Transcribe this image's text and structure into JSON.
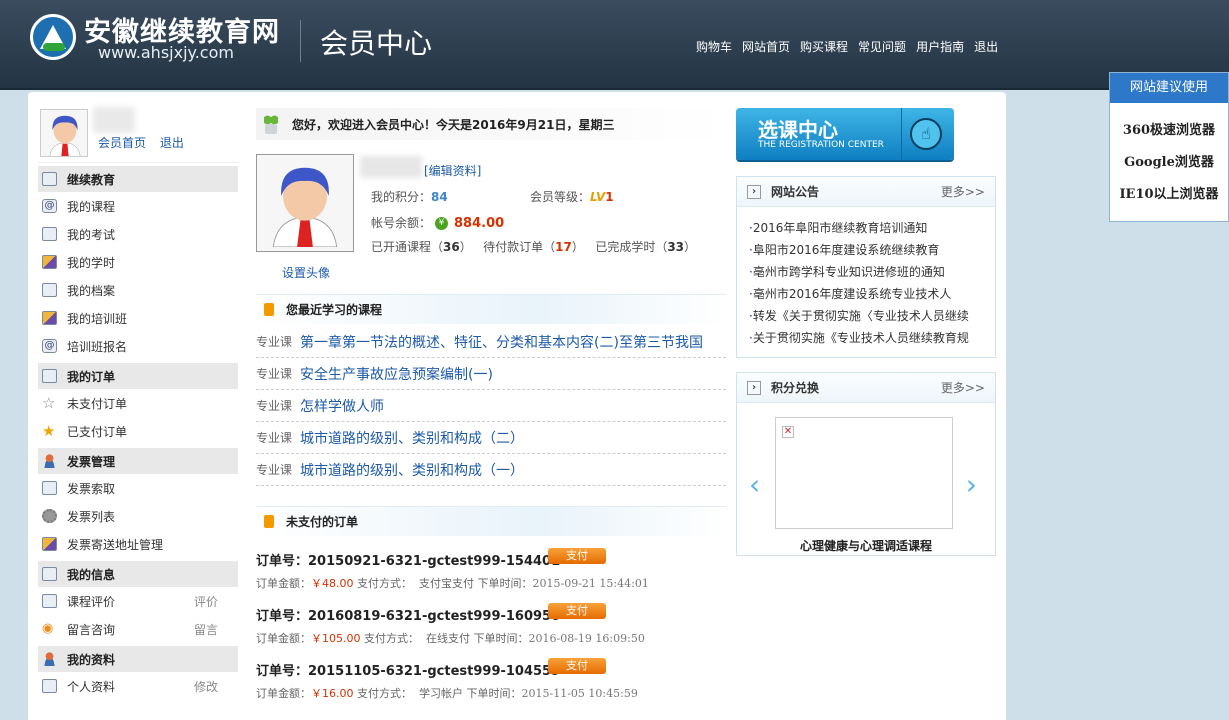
{
  "header": {
    "site_name": "安徽继续教育网",
    "site_url": "www.ahsjxjy.com",
    "section_title": "会员中心",
    "nav": [
      "购物车",
      "网站首页",
      "购买课程",
      "常见问题",
      "用户指南",
      "退出"
    ]
  },
  "suggest": {
    "title": "网站建议使用",
    "browsers": [
      "360极速浏览器",
      "Google浏览器",
      "IE10以上浏览器"
    ]
  },
  "sidebar": {
    "user_links": [
      "会员首页",
      "退出"
    ],
    "sections": [
      {
        "title": "继续教育",
        "items": [
          {
            "label": "我的课程"
          },
          {
            "label": "我的考试"
          },
          {
            "label": "我的学时"
          },
          {
            "label": "我的档案"
          },
          {
            "label": "我的培训班"
          },
          {
            "label": "培训班报名"
          }
        ]
      },
      {
        "title": "我的订单",
        "items": [
          {
            "label": "未支付订单"
          },
          {
            "label": "已支付订单"
          }
        ]
      },
      {
        "title": "发票管理",
        "items": [
          {
            "label": "发票索取"
          },
          {
            "label": "发票列表"
          },
          {
            "label": "发票寄送地址管理"
          }
        ]
      },
      {
        "title": "我的信息",
        "items": [
          {
            "label": "课程评价",
            "right": "评价"
          },
          {
            "label": "留言咨询",
            "right": "留言"
          }
        ]
      },
      {
        "title": "我的资料",
        "items": [
          {
            "label": "个人资料",
            "right": "修改"
          }
        ]
      }
    ]
  },
  "welcome": "您好，欢迎进入会员中心！今天是2016年9月21日，星期三",
  "profile": {
    "edit_link": "[编辑资料]",
    "points_label": "我的积分：",
    "points": "84",
    "level_label": "会员等级：",
    "level_badge": "LV",
    "level": "1",
    "balance_label": "帐号余额：",
    "balance_icon": "¥",
    "balance": "884.00",
    "opened_label": "已开通课程（",
    "opened": "36",
    "pending_label": "）   待付款订单（",
    "pending": "17",
    "done_label": "）   已完成学时（",
    "done": "33",
    "close_paren": "）",
    "set_avatar": "设置头像"
  },
  "recent": {
    "title": "您最近学习的课程",
    "courses": [
      {
        "tag": "专业课",
        "title": "第一章第一节法的概述、特征、分类和基本内容(二)至第三节我国"
      },
      {
        "tag": "专业课",
        "title": "安全生产事故应急预案编制(一)"
      },
      {
        "tag": "专业课",
        "title": "怎样学做人师"
      },
      {
        "tag": "专业课",
        "title": "城市道路的级别、类别和构成（二）"
      },
      {
        "tag": "专业课",
        "title": "城市道路的级别、类别和构成（一）"
      }
    ]
  },
  "unpaid": {
    "title": "未支付的订单",
    "order_label": "订单号：",
    "amount_label": "订单金额：",
    "pay_label": "支付方式：",
    "time_label": "下单时间：",
    "pay_button": "支付",
    "orders": [
      {
        "no": "20150921-6321-gctest999-154401",
        "amount": "￥48.00",
        "method": "支付宝支付",
        "time": "2015-09-21 15:44:01"
      },
      {
        "no": "20160819-6321-gctest999-160950",
        "amount": "￥105.00",
        "method": "在线支付",
        "time": "2016-08-19 16:09:50"
      },
      {
        "no": "20151105-6321-gctest999-104559",
        "amount": "￥16.00",
        "method": "学习帐户",
        "time": "2015-11-05 10:45:59"
      }
    ]
  },
  "banner": {
    "title": "选课中心",
    "subtitle": "THE REGISTRATION CENTER"
  },
  "notices": {
    "title": "网站公告",
    "more": "更多>>",
    "items": [
      "·2016年阜阳市继续教育培训通知",
      "·阜阳市2016年度建设系统继续教育",
      "·亳州市跨学科专业知识进修班的通知",
      "·亳州市2016年度建设系统专业技术人",
      "·转发《关于贯彻实施〈专业技术人员继续",
      "·关于贯彻实施《专业技术人员继续教育规"
    ]
  },
  "exchange": {
    "title": "积分兑换",
    "more": "更多>>",
    "item_title": "心理健康与心理调适课程",
    "broken_image": "✕"
  },
  "colors": {
    "header_bg": "#2c3e50",
    "accent": "#1d5aa8",
    "price": "#d63200",
    "pay": "#f08a1c"
  }
}
